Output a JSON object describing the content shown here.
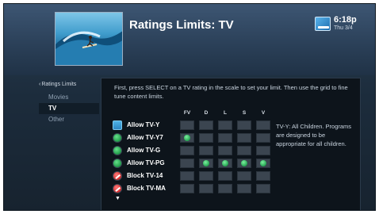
{
  "header": {
    "title": "Ratings Limits: TV",
    "time": "6:18p",
    "date": "Thu 3/4",
    "thumbnail": "surfer-wave-image",
    "status_icon": "dish-network-icon"
  },
  "sidebar": {
    "back_label": "Ratings Limits",
    "back_arrow": "‹",
    "items": [
      {
        "label": "Movies"
      },
      {
        "label": "TV"
      },
      {
        "label": "Other"
      }
    ]
  },
  "main": {
    "instructions": "First, press SELECT on a TV rating in the scale to set your limit. Then use the grid to fine tune content limits.",
    "columns": [
      "FV",
      "D",
      "L",
      "S",
      "V"
    ],
    "rows": [
      {
        "label": "Allow TV-Y",
        "status": "allow",
        "selected": true,
        "cells": [
          false,
          false,
          false,
          false,
          false
        ]
      },
      {
        "label": "Allow TV-Y7",
        "status": "allow",
        "selected": false,
        "cells": [
          true,
          false,
          false,
          false,
          false
        ]
      },
      {
        "label": "Allow TV-G",
        "status": "allow",
        "selected": false,
        "cells": [
          false,
          false,
          false,
          false,
          false
        ]
      },
      {
        "label": "Allow TV-PG",
        "status": "allow",
        "selected": false,
        "cells": [
          false,
          true,
          true,
          true,
          true
        ]
      },
      {
        "label": "Block TV-14",
        "status": "block",
        "selected": false,
        "cells": [
          false,
          false,
          false,
          false,
          false
        ]
      },
      {
        "label": "Block TV-MA",
        "status": "block",
        "selected": false,
        "cells": [
          false,
          false,
          false,
          false,
          false
        ]
      }
    ],
    "more_indicator": "▼",
    "description": "TV-Y: All Children. Programs are designed to be appropriate for all children."
  }
}
